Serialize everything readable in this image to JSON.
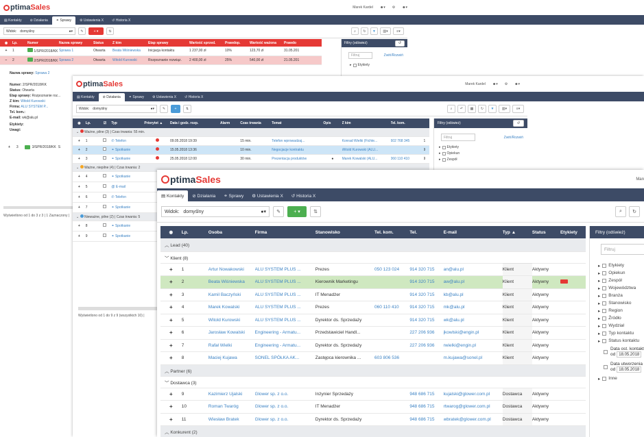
{
  "brand": {
    "logo_o": "O",
    "logo_a": "ptima",
    "logo_b": "Sales"
  },
  "user": {
    "name": "Marek Kardel"
  },
  "w1": {
    "tabs": [
      "Kontakty",
      "Działania",
      "Sprawy",
      "Ustawienia X",
      "Historia X"
    ],
    "view_label": "Widok:",
    "view_value": "domyślny",
    "columns": [
      "Lp.",
      "Numer",
      "Nazwa sprawy",
      "Status",
      "Z kim",
      "Etap sprawy",
      "Wartość sprzed.",
      "Prawdop.",
      "Wartość ważona",
      "Prawdo"
    ],
    "rows": [
      {
        "lp": "1",
        "num": "1/SPR/2018/KK",
        "name": "Sprawa 1",
        "status": "Otwarta",
        "zkim": "Beata Wiśniewska",
        "etap": "Inicjacja kontaktu",
        "val": "1 237,00 zł",
        "pr": "10%",
        "wv": "123,70 zł",
        "dt": "31.05.201"
      },
      {
        "lp": "2",
        "num": "2/SPR/2018/KK",
        "name": "Sprawa 2",
        "status": "Otwarta",
        "zkim": "Witold Kurowski",
        "etap": "Rozpoznanie rozwiąz.",
        "val": "2 400,00 zł",
        "pr": "25%",
        "wv": "540,00 zł",
        "dt": "21.05.201"
      }
    ],
    "detail_title_k": "Nazwa sprawy:",
    "detail_title_v": "Sprawa 2",
    "details": [
      {
        "k": "Numer:",
        "v": "2/SPR/2018/KK"
      },
      {
        "k": "Status:",
        "v": "Otwarta"
      },
      {
        "k": "Etap sprawy:",
        "v": "Rozpoznanie roz..."
      },
      {
        "k": "Z kim:",
        "v": "Witold Kurowski"
      },
      {
        "k": "Firma:",
        "v": "ALU SYSTEM P..."
      },
      {
        "k": "Tel. kom.:",
        "v": ""
      },
      {
        "k": "E-mail:",
        "v": "wk@alu.pl"
      },
      {
        "k": "Etykiety:",
        "v": ""
      },
      {
        "k": "Uwagi:",
        "v": ""
      }
    ],
    "row3": {
      "lp": "3",
      "num": "3/SPR/2018/KK",
      "x": "S"
    },
    "footer": "Wyświetlono od 1 do 3 z 3 | 1 Zaznaczony |",
    "filters_title": "Filtry (odśwież)",
    "filter_placeholder": "Filtruj",
    "collapse": "Zwiń/Rozwiń",
    "filter_item": "Etykiety"
  },
  "w2": {
    "tabs": [
      "Kontakty",
      "Działania",
      "Sprawy",
      "Ustawienia X",
      "Historia X"
    ],
    "view_label": "Widok:",
    "view_value": "domyślny",
    "columns": [
      "Lp.",
      "Typ",
      "Priorytet",
      "Data i godz. rozp.",
      "Alarm",
      "Czas trwania",
      "Temat",
      "Opis",
      "Z kim",
      "Tel. kom."
    ],
    "group1": "Ważne, pilne (3) | Czas trwania: 55 min.",
    "group2": "Ważne, niepilne (4) | Czas trwania: 2",
    "group3": "Nieważne, pilne (2) | Czas trwania: 5",
    "rows": [
      {
        "lp": "1",
        "typ": "Telefon",
        "date": "09.05.2018 19:39",
        "dur": "15 min.",
        "temat": "Telefon wprowadzaj...",
        "zkim": "Konrad Wielki (Fichte...",
        "tel": "602 768 345",
        "x": "1"
      },
      {
        "lp": "2",
        "typ": "Spotkanie",
        "date": "15.05.2018 13:36",
        "dur": "10 min.",
        "temat": "Negocjacje kontraktu",
        "zkim": "Witold Kurowski (ALU...",
        "tel": "",
        "x": "9"
      },
      {
        "lp": "3",
        "typ": "Spotkanie",
        "date": "25.05.2018 12:00",
        "dur": "30 min.",
        "temat": "Prezentacja produktów",
        "zkim": "Marek Kowalski (ALU...",
        "tel": "060 110 410",
        "x": "9"
      }
    ],
    "rows_b": [
      {
        "lp": "4",
        "typ": "Spotkanie"
      },
      {
        "lp": "5",
        "typ": "E-mail"
      },
      {
        "lp": "6",
        "typ": "Telefon"
      },
      {
        "lp": "7",
        "typ": "Spotkanie"
      }
    ],
    "rows_c": [
      {
        "lp": "8",
        "typ": "Spotkanie"
      },
      {
        "lp": "9",
        "typ": "Spotkanie"
      }
    ],
    "footer": "Wyświetlono od 1 do 9 z 9 (wszystkich 10) |",
    "filters_title": "Filtry (odśwież)",
    "filter_placeholder": "Filtruj",
    "collapse": "Zwiń/Rozwiń",
    "filter_items": [
      "Etykiety",
      "Opiekun",
      "Zespół"
    ]
  },
  "w3": {
    "tabs": [
      "Kontakty",
      "Działania",
      "Sprawy",
      "Ustawienia X",
      "Historia X"
    ],
    "view_label": "Widok:",
    "view_value": "domyślny",
    "columns": [
      "Lp.",
      "Osoba",
      "Firma",
      "Stanowisko",
      "Tel. kom.",
      "Tel.",
      "E-mail",
      "Typ",
      "Status",
      "Etykiety"
    ],
    "group_lead": "Lead (40)",
    "group_klient": "Klient (8)",
    "group_partner": "Partner (6)",
    "group_dostawca": "Dostawca (3)",
    "group_konkurent": "Konkurent (2)",
    "rows": [
      {
        "lp": "1",
        "osoba": "Artur Nowakowski",
        "firma": "ALU SYSTEM PLUS ...",
        "stan": "Prezes",
        "kom": "050 123 024",
        "tel": "914 320 715",
        "mail": "an@alu.pl",
        "typ": "Klient",
        "status": "Aktywny"
      },
      {
        "lp": "2",
        "osoba": "Beata Wiśniewska",
        "firma": "ALU SYSTEM PLUS ...",
        "stan": "Kierownik Marketingu",
        "kom": "",
        "tel": "914 320 715",
        "mail": "aw@alu.pl",
        "typ": "Klient",
        "status": "Aktywny"
      },
      {
        "lp": "3",
        "osoba": "Kamil Baczyński",
        "firma": "ALU SYSTEM PLUS ...",
        "stan": "IT Menadżer",
        "kom": "",
        "tel": "914 320 715",
        "mail": "kb@alu.pl",
        "typ": "Klient",
        "status": "Aktywny"
      },
      {
        "lp": "4",
        "osoba": "Marek Kowalski",
        "firma": "ALU SYSTEM PLUS ...",
        "stan": "Prezes",
        "kom": "060 110 410",
        "tel": "914 320 715",
        "mail": "mk@alu.pl",
        "typ": "Klient",
        "status": "Aktywny"
      },
      {
        "lp": "5",
        "osoba": "Witold Kurowski",
        "firma": "ALU SYSTEM PLUS ...",
        "stan": "Dyrektor ds. Sprzedaży",
        "kom": "",
        "tel": "914 320 715",
        "mail": "wk@alu.pl",
        "typ": "Klient",
        "status": "Aktywny"
      },
      {
        "lp": "6",
        "osoba": "Jarosław Kowalski",
        "firma": "Engineering - Armatu...",
        "stan": "Przedstawiciel Handl...",
        "kom": "",
        "tel": "227 206 936",
        "mail": "jkowlski@engin.pl",
        "typ": "Klient",
        "status": "Aktywny"
      },
      {
        "lp": "7",
        "osoba": "Rafał Wielki",
        "firma": "Engineering - Armatu...",
        "stan": "Dyrektor ds. Sprzedaży",
        "kom": "",
        "tel": "227 206 936",
        "mail": "rwielki@engin.pl",
        "typ": "Klient",
        "status": "Aktywny"
      },
      {
        "lp": "8",
        "osoba": "Maciej Kujawa",
        "firma": "SONEL SPÓŁKA AK...",
        "stan": "Zastępca kierownika ...",
        "kom": "603 806 536",
        "tel": "",
        "mail": "m.kujawa@sonel.pl",
        "typ": "Klient",
        "status": "Aktywny"
      }
    ],
    "rows_d": [
      {
        "lp": "9",
        "osoba": "Kazimierz Ujalski",
        "firma": "Glower sp. z o.o.",
        "stan": "Inżynier Sprzedaży",
        "kom": "",
        "tel": "948 686 715",
        "mail": "kujalski@glower.com.pl",
        "typ": "Dostawca",
        "status": "Aktywny"
      },
      {
        "lp": "10",
        "osoba": "Roman Twaróg",
        "firma": "Glower sp. z o.o.",
        "stan": "IT Menadżer",
        "kom": "",
        "tel": "948 686 715",
        "mail": "rtwarog@glower.com.pl",
        "typ": "Dostawca",
        "status": "Aktywny"
      },
      {
        "lp": "11",
        "osoba": "Wiesław Bratek",
        "firma": "Glower sp. z o.o.",
        "stan": "Dyrektor ds. Sprzedaży",
        "kom": "",
        "tel": "948 686 715",
        "mail": "wbratek@glower.com.pl",
        "typ": "Dostawca",
        "status": "Aktywny"
      }
    ],
    "filters_title": "Filtry (odśwież)",
    "filter_placeholder": "Filtruj",
    "filter_items": [
      "Etykiety",
      "Opiekun",
      "Zespół",
      "Województwa",
      "Branża",
      "Stanowisko",
      "Region",
      "Źródło",
      "Wydział",
      "Typ kontaktu",
      "Status kontaktu"
    ],
    "date1_label": "Data ost. kontakt",
    "date1_od": "od",
    "date1_val": "18.05.2018",
    "date2_label": "Data utworzenia",
    "date2_od": "od",
    "date2_val": "18.05.2018",
    "filter_last": "Inne"
  },
  "colors": {
    "nav": "#3d4b66",
    "accent": "#e53935",
    "blue": "#4a9bd8",
    "green": "#4caf50",
    "link": "#3b82c4"
  }
}
